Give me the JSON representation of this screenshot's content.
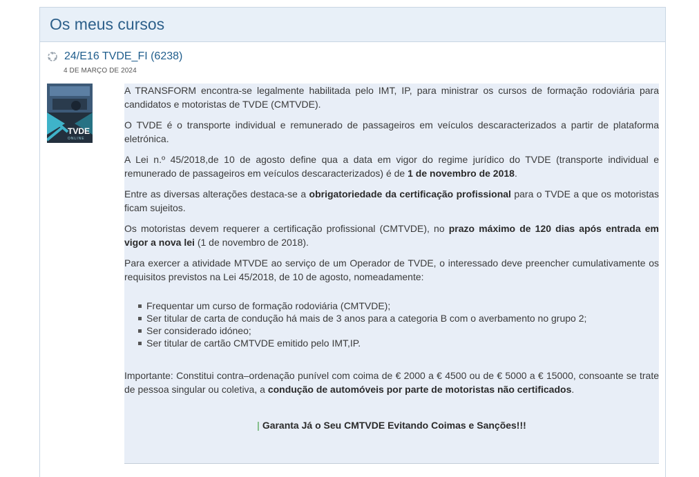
{
  "panel": {
    "title": "Os meus cursos"
  },
  "course": {
    "name": "24/E16 TVDE_FI (6238)",
    "date": "4 DE MARÇO DE 2024",
    "thumbnail_brand": "TVDE",
    "thumbnail_sub": "ONLINE"
  },
  "summary": {
    "p1": "A TRANSFORM encontra-se legalmente habilitada pelo IMT, IP, para ministrar os cursos de formação rodoviária para candidatos e motoristas de TVDE (CMTVDE).",
    "p2": "O TVDE é o transporte individual e remunerado de passageiros em veículos descaracterizados a partir de plataforma eletrónica.",
    "p3_a": "A Lei n.º 45/2018,de 10 de agosto define qua a data em vigor do regime jurídico do TVDE (transporte individual e remunerado de passageiros em veículos descaracterizados)  é de ",
    "p3_b": "1 de novembro de 2018",
    "p3_c": ".",
    "p4_a": "Entre as diversas alterações destaca-se a ",
    "p4_b": "obrigatoriedade da certificação profissional",
    "p4_c": " para o TVDE a que os motoristas ficam sujeitos.",
    "p5_a": "Os motoristas devem requerer a certificação profissional (CMTVDE), no ",
    "p5_b": "prazo máximo de 120 dias após entrada em vigor a nova lei",
    "p5_c": " (1 de novembro de 2018).",
    "p6": "Para exercer a atividade MTVDE ao serviço de um Operador de TVDE, o interessado deve preencher cumulativamente os requisitos previstos na Lei 45/2018, de 10 de agosto, nomeadamente:",
    "requirements": [
      "Frequentar um curso de formação rodoviária (CMTVDE);",
      "Ser titular de carta de condução há mais de 3 anos para a categoria B com o averbamento no grupo 2;",
      "Ser considerado idóneo;",
      "Ser titular de cartão CMTVDE emitido pelo IMT,IP."
    ],
    "p7_a": "Importante: Constitui contra–ordenação punível com coima de € 2000 a € 4500 ou de € 5000 a € 15000, consoante se trate de pessoa singular ou coletiva, a ",
    "p7_b": "condução de automóveis por parte de motoristas não certificados",
    "p7_c": ".",
    "cta_bar": "|",
    "cta": "Garanta Já o Seu CMTVDE Evitando Coimas e Sanções!!!"
  }
}
